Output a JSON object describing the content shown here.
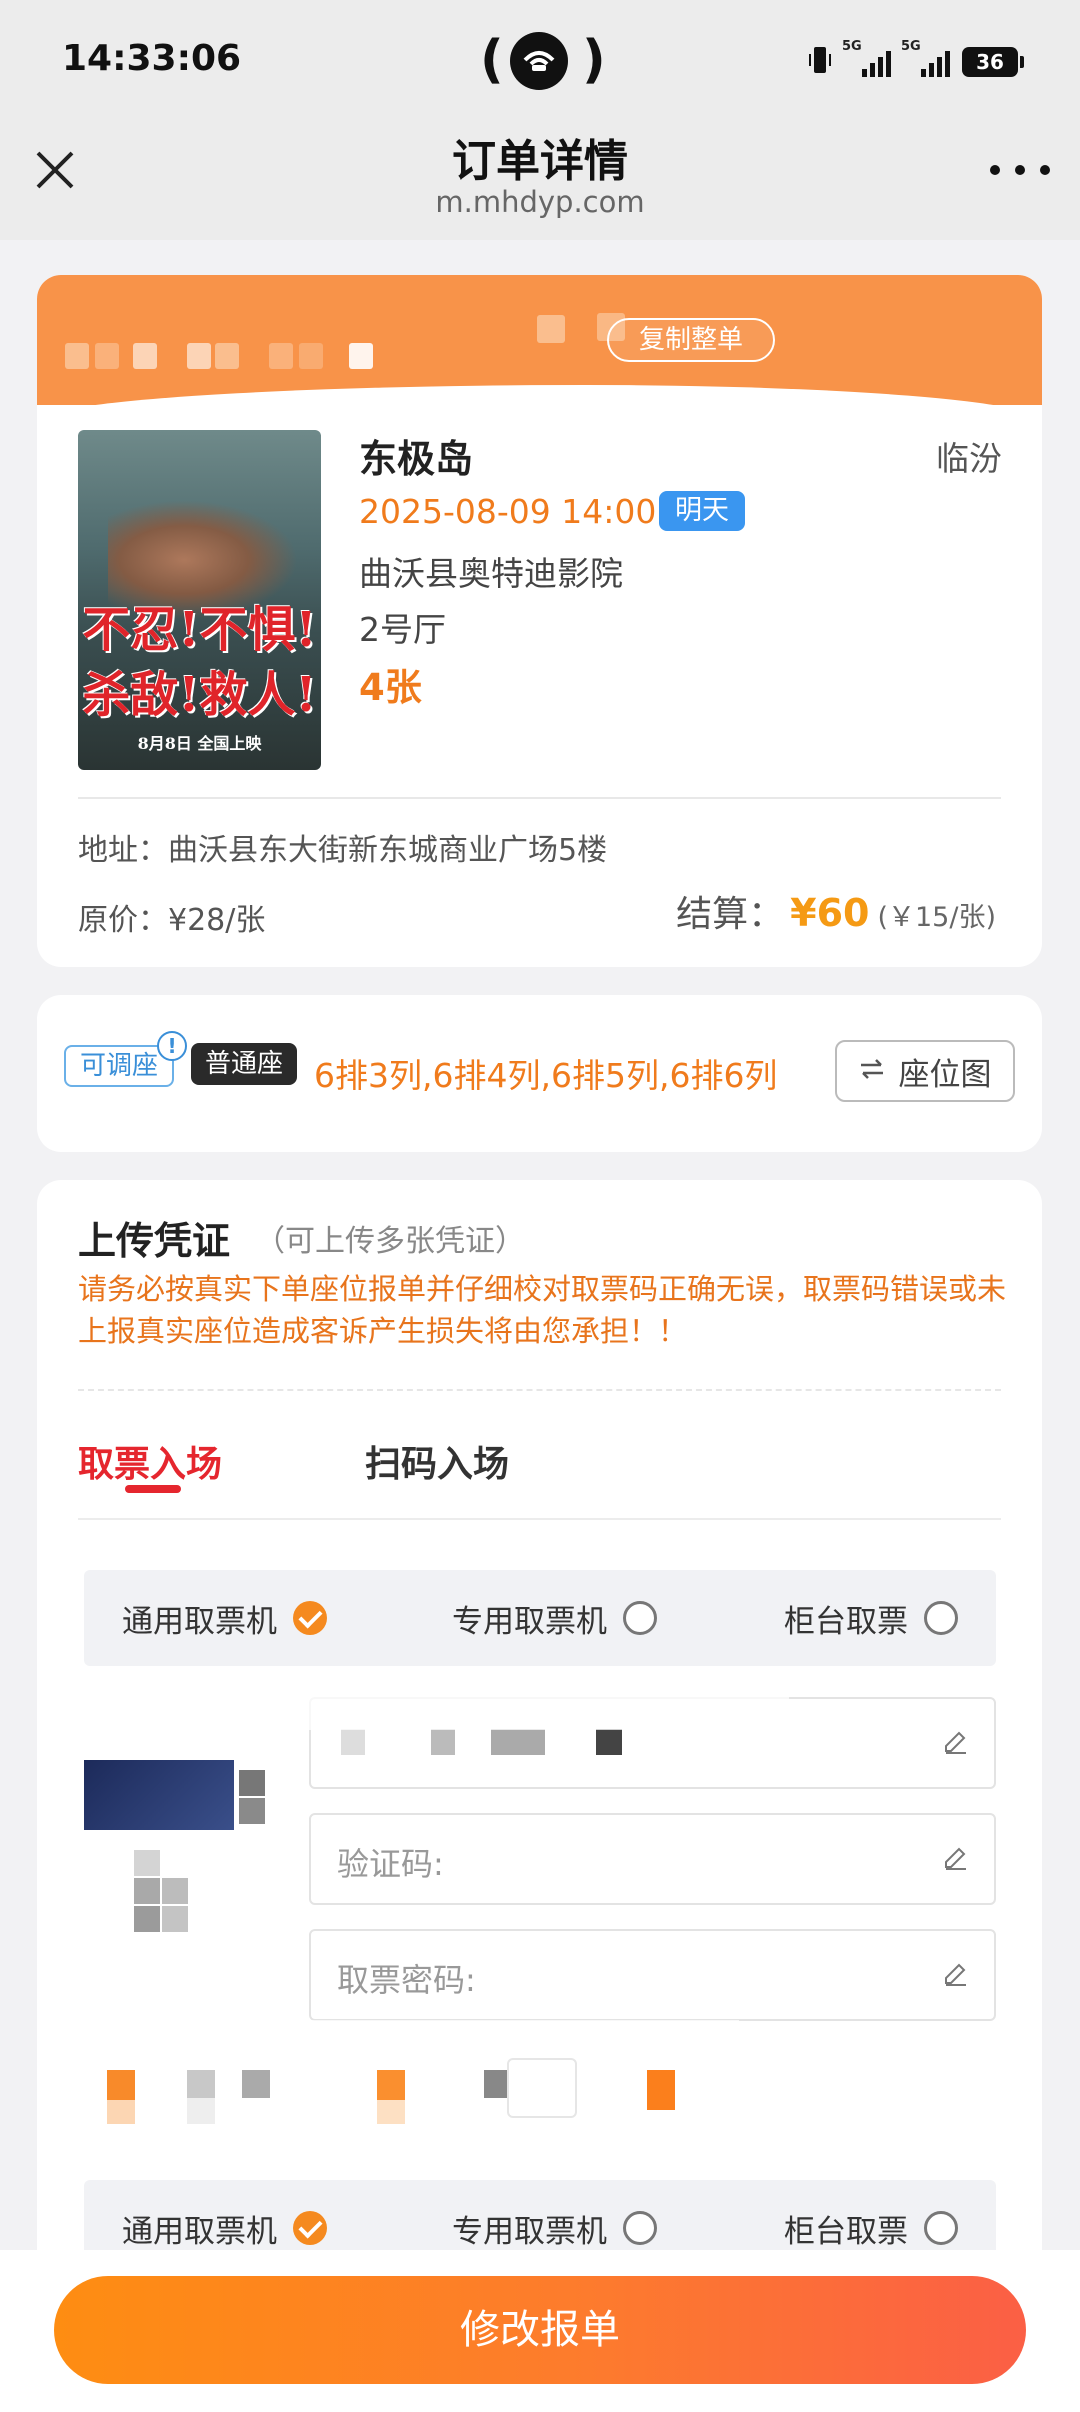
{
  "status_bar": {
    "time": "14:33:06",
    "battery": "36",
    "network": "5G"
  },
  "nav": {
    "title": "订单详情",
    "url": "m.mhdyp.com"
  },
  "order": {
    "copy_label": "复制整单",
    "movie_title": "东极岛",
    "city": "临汾",
    "showtime": "2025-08-09 14:00",
    "day_tag": "明天",
    "cinema": "曲沃县奥特迪影院",
    "hall": "2号厅",
    "ticket_count": "4张",
    "poster_line1": "不忍!不惧!",
    "poster_line2": "杀敌!救人!",
    "poster_line3": "8月8日 全国上映",
    "address_label": "地址：",
    "address": "曲沃县东大街新东城商业广场5楼",
    "original_price": "原价：¥28/张",
    "settle_label": "结算：",
    "settle_amount": "¥60",
    "settle_unit": "(￥15/张)"
  },
  "seats": {
    "adjustable_tag": "可调座",
    "info_mark": "!",
    "normal_tag": "普通座",
    "seat_list": "6排3列,6排4列,6排5列,6排6列",
    "seat_map_label": "座位图",
    "seat_map_icon": "swap-icon"
  },
  "upload": {
    "title": "上传凭证",
    "hint": "（可上传多张凭证）",
    "warning": "请务必按真实下单座位报单并仔细校对取票码正确无误，取票码错误或未上报真实座位造成客诉产生损失将由您承担！！",
    "tabs": [
      "取票入场",
      "扫码入场"
    ],
    "machine_options": [
      "通用取票机",
      "专用取票机",
      "柜台取票"
    ],
    "field_verify_placeholder": "验证码:",
    "field_password_placeholder": "取票密码:"
  },
  "colors": {
    "accent_orange": "#f07b1c",
    "header_orange": "#f89349",
    "tab_red": "#e5262e",
    "tag_blue": "#3a96f0"
  },
  "submit_label": "修改报单"
}
